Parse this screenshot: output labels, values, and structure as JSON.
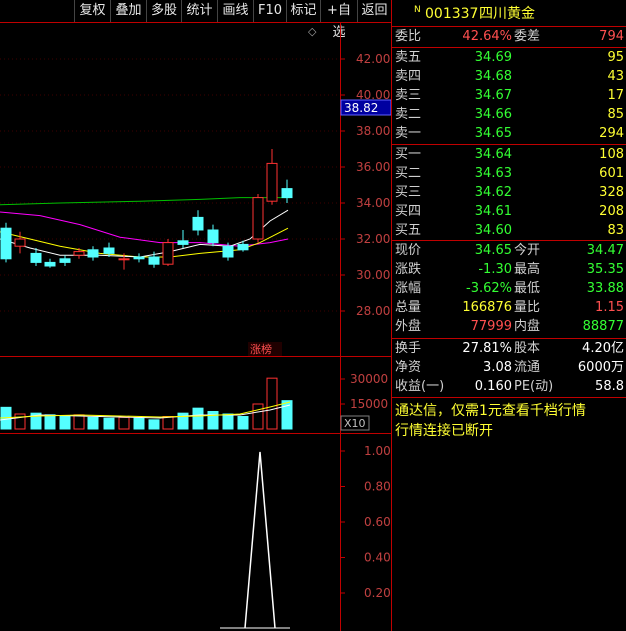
{
  "toolbar": {
    "items": [
      "复权",
      "叠加",
      "多股",
      "统计",
      "画线",
      "F10",
      "标记",
      "+自选",
      "返回"
    ]
  },
  "chart": {
    "price_ticks": [
      "42.00",
      "40.00",
      "38.00",
      "36.00",
      "34.00",
      "32.00",
      "30.00",
      "28.00"
    ],
    "current_price_tag": "38.82",
    "badge_text": "涨榜",
    "diamond": "◇",
    "volume_ticks": [
      "30000",
      "15000"
    ],
    "volume_unit": "X10",
    "indicator_ticks": [
      "1.00",
      "0.80",
      "0.60",
      "0.40",
      "0.20"
    ]
  },
  "stock": {
    "marker": "N",
    "code": "001337",
    "name": "四川黄金"
  },
  "weibi": {
    "label": "委比",
    "value": "42.64%",
    "label2": "委差",
    "value2": "794"
  },
  "asks": [
    {
      "label": "卖五",
      "price": "34.69",
      "volume": "95"
    },
    {
      "label": "卖四",
      "price": "34.68",
      "volume": "43"
    },
    {
      "label": "卖三",
      "price": "34.67",
      "volume": "17"
    },
    {
      "label": "卖二",
      "price": "34.66",
      "volume": "85"
    },
    {
      "label": "卖一",
      "price": "34.65",
      "volume": "294"
    }
  ],
  "bids": [
    {
      "label": "买一",
      "price": "34.64",
      "volume": "108"
    },
    {
      "label": "买二",
      "price": "34.63",
      "volume": "601"
    },
    {
      "label": "买三",
      "price": "34.62",
      "volume": "328"
    },
    {
      "label": "买四",
      "price": "34.61",
      "volume": "208"
    },
    {
      "label": "买五",
      "price": "34.60",
      "volume": "83"
    }
  ],
  "quote": [
    {
      "l1": "现价",
      "v1": "34.65",
      "l2": "今开",
      "v2": "34.47"
    },
    {
      "l1": "涨跌",
      "v1": "-1.30",
      "l2": "最高",
      "v2": "35.35"
    },
    {
      "l1": "涨幅",
      "v1": "-3.62%",
      "l2": "最低",
      "v2": "33.88"
    },
    {
      "l1": "总量",
      "v1": "166876",
      "l2": "量比",
      "v2": "1.15"
    },
    {
      "l1": "外盘",
      "v1": "77999",
      "l2": "内盘",
      "v2": "88877"
    }
  ],
  "finance": [
    {
      "l1": "换手",
      "v1": "27.81%",
      "l2": "股本",
      "v2": "4.20亿"
    },
    {
      "l1": "净资",
      "v1": "3.08",
      "l2": "流通",
      "v2": "6000万"
    },
    {
      "l1": "收益(一)",
      "v1": "0.160",
      "l2": "PE(动)",
      "v2": "58.8"
    }
  ],
  "notice": {
    "ad": "通达信，仅需1元查看千档行情",
    "status": "行情连接已断开"
  },
  "colors": {
    "up": "#ff3232",
    "down": "#54ffff",
    "frame": "#c00000",
    "ma_white": "#ffffff",
    "ma_yellow": "#ffff00",
    "ma_magenta": "#ff00ff",
    "ma_green": "#00c000"
  }
}
